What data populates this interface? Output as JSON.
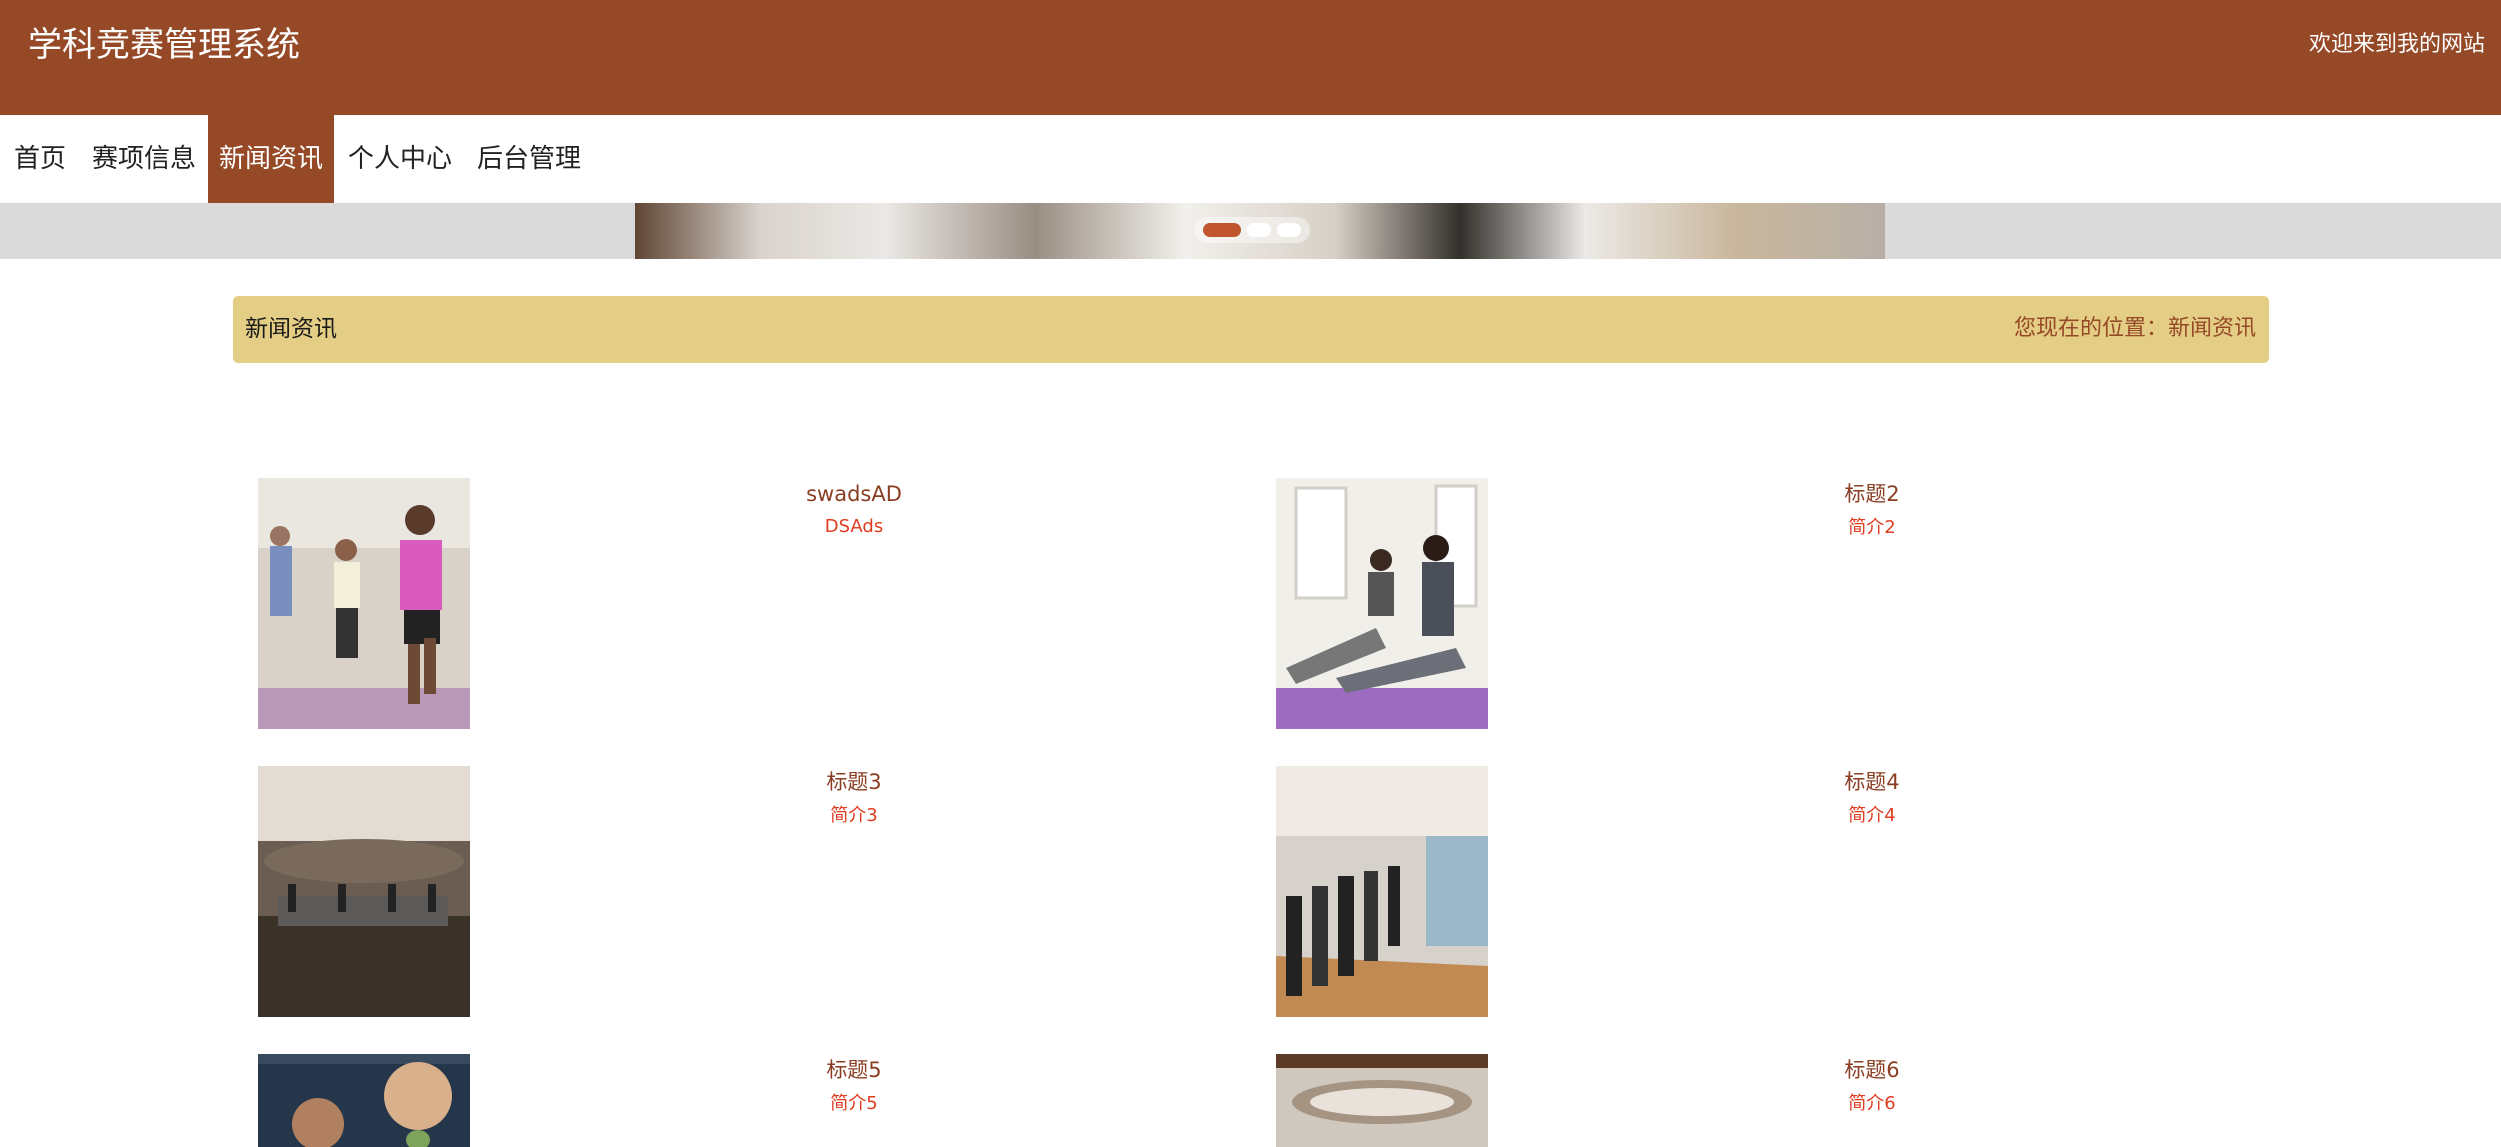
{
  "header": {
    "title": "学科竞赛管理系统",
    "welcome": "欢迎来到我的网站"
  },
  "nav": [
    {
      "label": "首页"
    },
    {
      "label": "赛项信息"
    },
    {
      "label": "新闻资讯",
      "active": true
    },
    {
      "label": "个人中心"
    },
    {
      "label": "后台管理"
    }
  ],
  "banner": {
    "active_slide": 1,
    "slide_count": 3
  },
  "crumb": {
    "heading": "新闻资讯",
    "location": "您现在的位置：新闻资讯"
  },
  "news": [
    {
      "title": "swadsAD",
      "summary": "DSAds"
    },
    {
      "title": "标题2",
      "summary": "简介2"
    },
    {
      "title": "标题3",
      "summary": "简介3"
    },
    {
      "title": "标题4",
      "summary": "简介4"
    },
    {
      "title": "标题5",
      "summary": "简介5"
    },
    {
      "title": "标题6",
      "summary": "简介6"
    }
  ],
  "colors": {
    "brand": "#954927",
    "crumb_bg": "#e4cd84",
    "summary": "#e03c1f",
    "title": "#8a3d21"
  }
}
